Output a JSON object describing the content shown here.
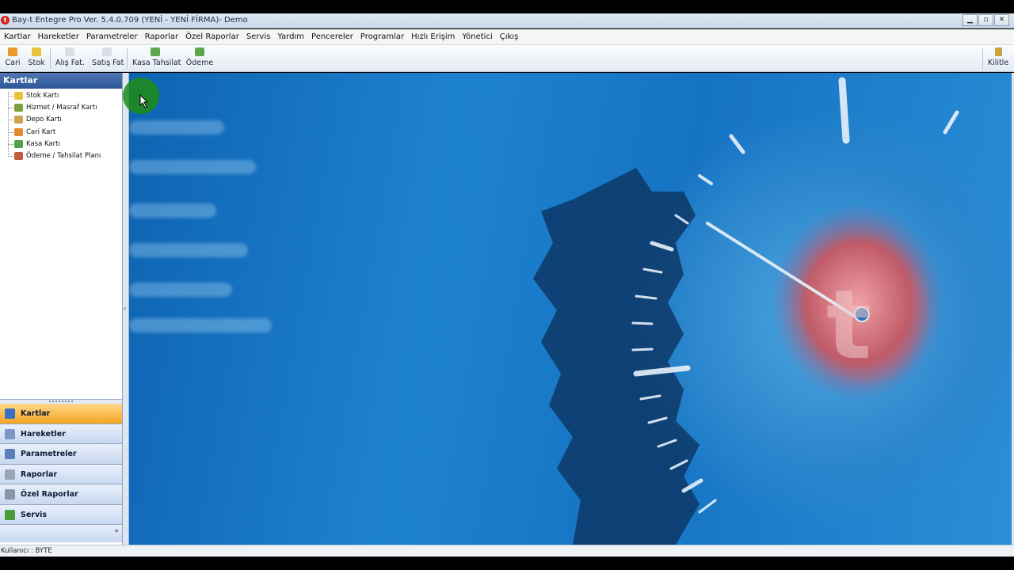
{
  "window": {
    "title": "Bay-t Entegre Pro Ver. 5.4.0.709 (YENİ - YENİ FİRMA)- Demo",
    "app_icon": "t"
  },
  "menu": {
    "items": [
      "Kartlar",
      "Hareketler",
      "Parametreler",
      "Raporlar",
      "Özel Raporlar",
      "Servis",
      "Yardım",
      "Pencereler",
      "Programlar",
      "Hızlı Erişim",
      "Yönetici",
      "Çıkış"
    ]
  },
  "toolbar": {
    "buttons": [
      {
        "label": "Cari",
        "icon": "cari-icon",
        "color": "#e59a2a"
      },
      {
        "label": "Stok",
        "icon": "stok-icon",
        "color": "#e8c23a"
      },
      {
        "label": "Alış Fat.",
        "icon": "alis-fatura-icon",
        "color": "#d9dee6"
      },
      {
        "label": "Satış Fat",
        "icon": "satis-fatura-icon",
        "color": "#d9dee6"
      },
      {
        "label": "Kasa Tahsilat",
        "icon": "kasa-tahsilat-icon",
        "color": "#5aa84a"
      },
      {
        "label": "Ödeme",
        "icon": "odeme-icon",
        "color": "#5aa84a"
      }
    ],
    "lock_label": "Kilitle"
  },
  "left_panel": {
    "header": "Kartlar",
    "tree": [
      {
        "label": "Stok Kartı",
        "color": "#e8c23a"
      },
      {
        "label": "Hizmet / Masraf Kartı",
        "color": "#7a9e3a"
      },
      {
        "label": "Depo Kartı",
        "color": "#caa54a"
      },
      {
        "label": "Cari Kart",
        "color": "#e08a2a"
      },
      {
        "label": "Kasa Kartı",
        "color": "#4fa24a"
      },
      {
        "label": "Ödeme / Tahsilat Planı",
        "color": "#c05a3a"
      }
    ],
    "nav": [
      {
        "label": "Kartlar",
        "active": true,
        "color": "#3a6fc4"
      },
      {
        "label": "Hareketler",
        "active": false,
        "color": "#7d98c4"
      },
      {
        "label": "Parametreler",
        "active": false,
        "color": "#5a7fb8"
      },
      {
        "label": "Raporlar",
        "active": false,
        "color": "#9aa6b6"
      },
      {
        "label": "Özel Raporlar",
        "active": false,
        "color": "#8a96a8"
      },
      {
        "label": "Servis",
        "active": false,
        "color": "#4a9a3a"
      }
    ],
    "more_chevron": "»"
  },
  "status": {
    "user_text": "Kullanıcı : BYTE"
  }
}
